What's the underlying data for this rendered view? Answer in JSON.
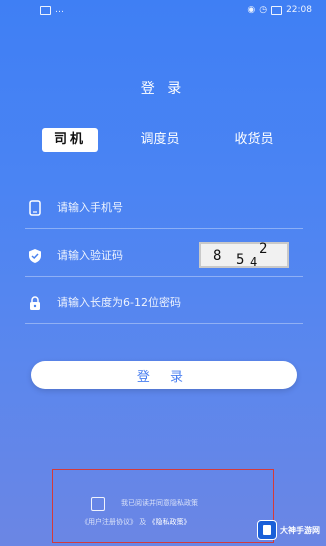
{
  "status_bar": {
    "carrier": "…",
    "time": "22:08"
  },
  "title": "登 录",
  "tabs": [
    {
      "label": "司机"
    },
    {
      "label": "调度员"
    },
    {
      "label": "收货员"
    }
  ],
  "fields": {
    "phone_placeholder": "请输入手机号",
    "code_placeholder": "请输入验证码",
    "password_placeholder": "请输入长度为6-12位密码"
  },
  "captcha": {
    "chars": [
      "8",
      "5",
      "4",
      "2"
    ]
  },
  "login_button": "登 录",
  "agreement": {
    "line1": "我已阅读并同意隐私政策",
    "line2_prefix": "《用户注册协议》",
    "line2_joiner": "及",
    "line2_link": "《隐私政策》"
  },
  "watermark": {
    "text": "大神手游网"
  }
}
